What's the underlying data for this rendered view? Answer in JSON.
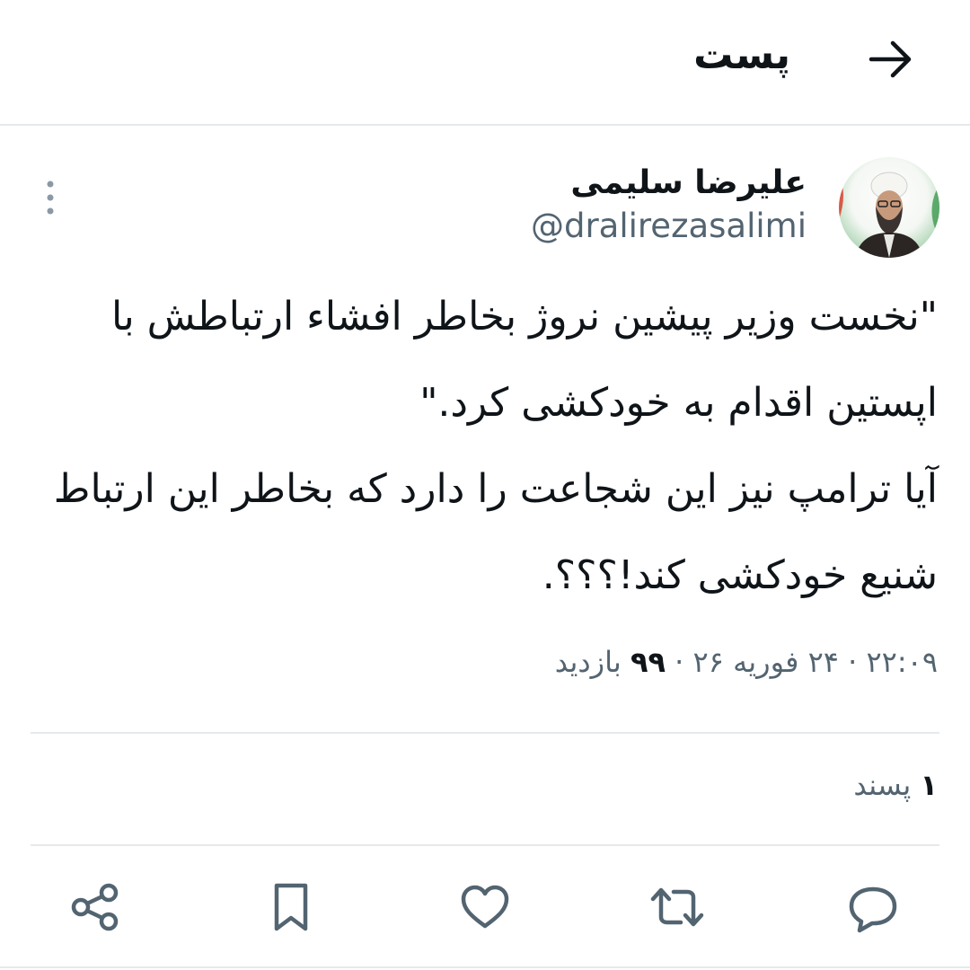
{
  "header": {
    "title": "پست",
    "back_icon": "arrow-right-icon"
  },
  "author": {
    "name": "علیرضا سلیمی",
    "handle": "@dralirezasalimi",
    "avatar_icon": "avatar"
  },
  "post": {
    "lines": [
      "\"نخست وزیر پیشین نروژ بخاطر افشاء ارتباطش با",
      "اپستین اقدام به خودکشی کرد.\"",
      "آیا ترامپ نیز این شجاعت را دارد که بخاطر این ارتباط",
      "شنیع خودکشی کند!؟؟؟."
    ],
    "meta": {
      "time": "۲۲:۰۹",
      "date": "۲۴ فوریه ۲۶",
      "views_count": "۹۹",
      "views_label": "بازدید",
      "separator": "·"
    },
    "likes": {
      "count": "۱",
      "label": "پسند"
    }
  },
  "actions": [
    {
      "name": "reply",
      "icon": "comment-icon"
    },
    {
      "name": "repost",
      "icon": "repost-icon"
    },
    {
      "name": "like",
      "icon": "heart-icon"
    },
    {
      "name": "bookmark",
      "icon": "bookmark-icon"
    },
    {
      "name": "share",
      "icon": "share-icon"
    }
  ],
  "colors": {
    "text": "#0f1419",
    "secondary": "#536471",
    "divider": "#e6e9ec"
  }
}
